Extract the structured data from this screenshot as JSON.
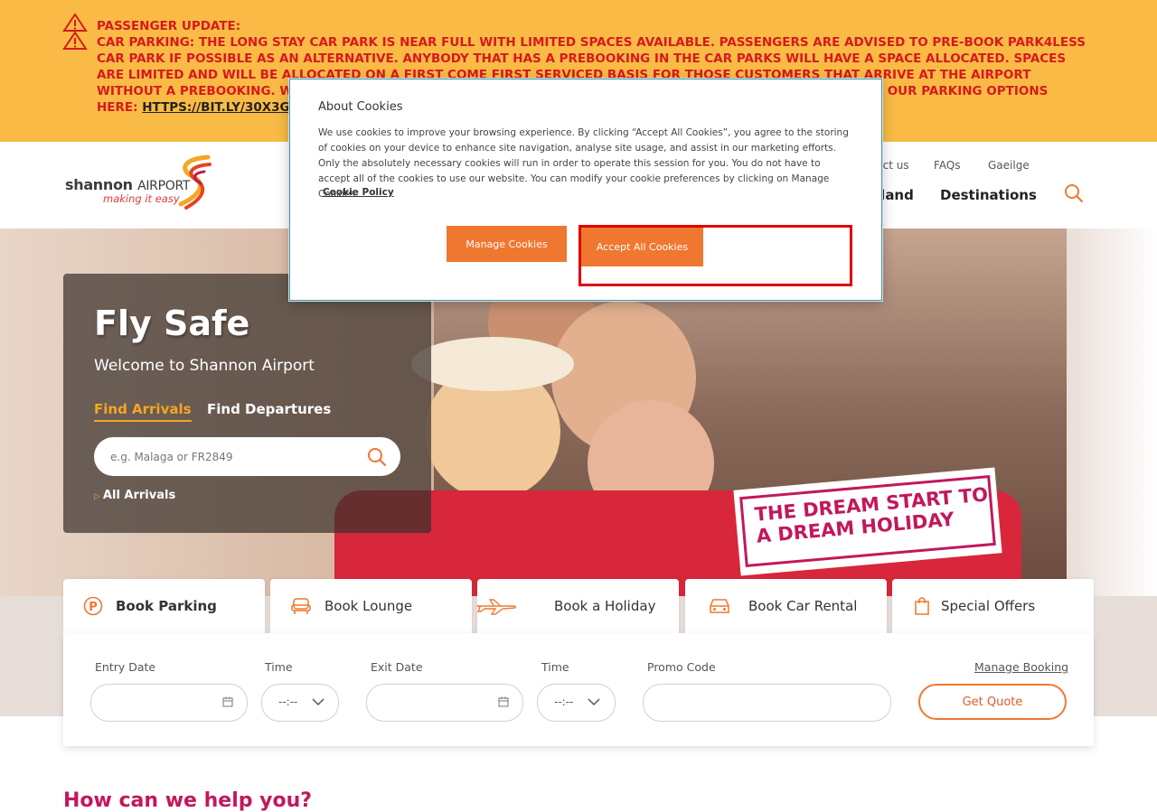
{
  "alert": {
    "heading": "PASSENGER UPDATE:",
    "message": "CAR PARKING: THE LONG STAY CAR PARK IS NEAR FULL WITH LIMITED SPACES AVAILABLE. PASSENGERS ARE ADVISED TO PRE-BOOK PARK4LESS CAR PARK IF POSSIBLE AS AN ALTERNATIVE. ANYBODY THAT HAS A PREBOOKING IN THE CAR PARKS WILL HAVE A SPACE ALLOCATED. SPACES ARE LIMITED AND WILL BE ALLOCATED ON A FIRST COME FIRST SERVICED BASIS FOR THOSE CUSTOMERS THAT ARRIVE AT THE AIRPORT WITHOUT A PREBOOKING. WE RECOMMEND PRE-BOOKING YOUR PARKING. FOR MORE INFORMATION AND TO VIEW OUR PARKING OPTIONS HERE:",
    "link": "HTTPS://BIT.LY/30X3GWP",
    "icon": "warning-icon",
    "color": "#d7191f",
    "background": "#f9bb45"
  },
  "header": {
    "logo_name": "shannon",
    "logo_airport": "AIRPORT",
    "logo_tagline": "making it easy",
    "top_links": [
      "ntact us",
      "FAQs",
      "Gaeilge"
    ],
    "nav": [
      "eland",
      "Destinations"
    ]
  },
  "hero": {
    "title": "Fly Safe",
    "subtitle": "Welcome to Shannon Airport",
    "tab_arrivals": "Find Arrivals",
    "tab_departures": "Find Departures",
    "search_placeholder": "e.g. Malaga or FR2849",
    "all_arrivals": "All Arrivals",
    "sticker_line1": "THE DREAM START TO",
    "sticker_line2": "A DREAM HOLIDAY"
  },
  "booking": {
    "tabs": [
      {
        "label": "Book Parking",
        "icon": "parking-icon"
      },
      {
        "label": "Book Lounge",
        "icon": "lounge-chair-icon"
      },
      {
        "label": "Book a Holiday",
        "icon": "plane-icon"
      },
      {
        "label": "Book Car Rental",
        "icon": "car-icon"
      },
      {
        "label": "Special Offers",
        "icon": "shopping-bag-icon"
      }
    ],
    "entry_date_label": "Entry Date",
    "time_label": "Time",
    "exit_date_label": "Exit Date",
    "time2_label": "Time",
    "promo_label": "Promo Code",
    "time_placeholder": "--:--",
    "manage_booking": "Manage Booking",
    "get_quote": "Get Quote"
  },
  "bottom_heading": "How can we help you?",
  "cookie": {
    "title": "About Cookies",
    "body": "We use cookies to improve your browsing experience. By clicking “Accept All Cookies”, you agree to the storing of cookies on your device to enhance site navigation, analyse site usage, and assist in our marketing efforts. Only the absolutely necessary cookies will run in order to operate this session for you. You do not have to accept all of the cookies to use our website. You can modify your cookie preferences by clicking on Manage Cookies.",
    "policy_link": "Cookie Policy",
    "manage_button": "Manage Cookies",
    "accept_button": "Accept All Cookies"
  },
  "colors": {
    "accent": "#f0772f",
    "brand_pink": "#c2185b",
    "focus": "#e00000"
  }
}
